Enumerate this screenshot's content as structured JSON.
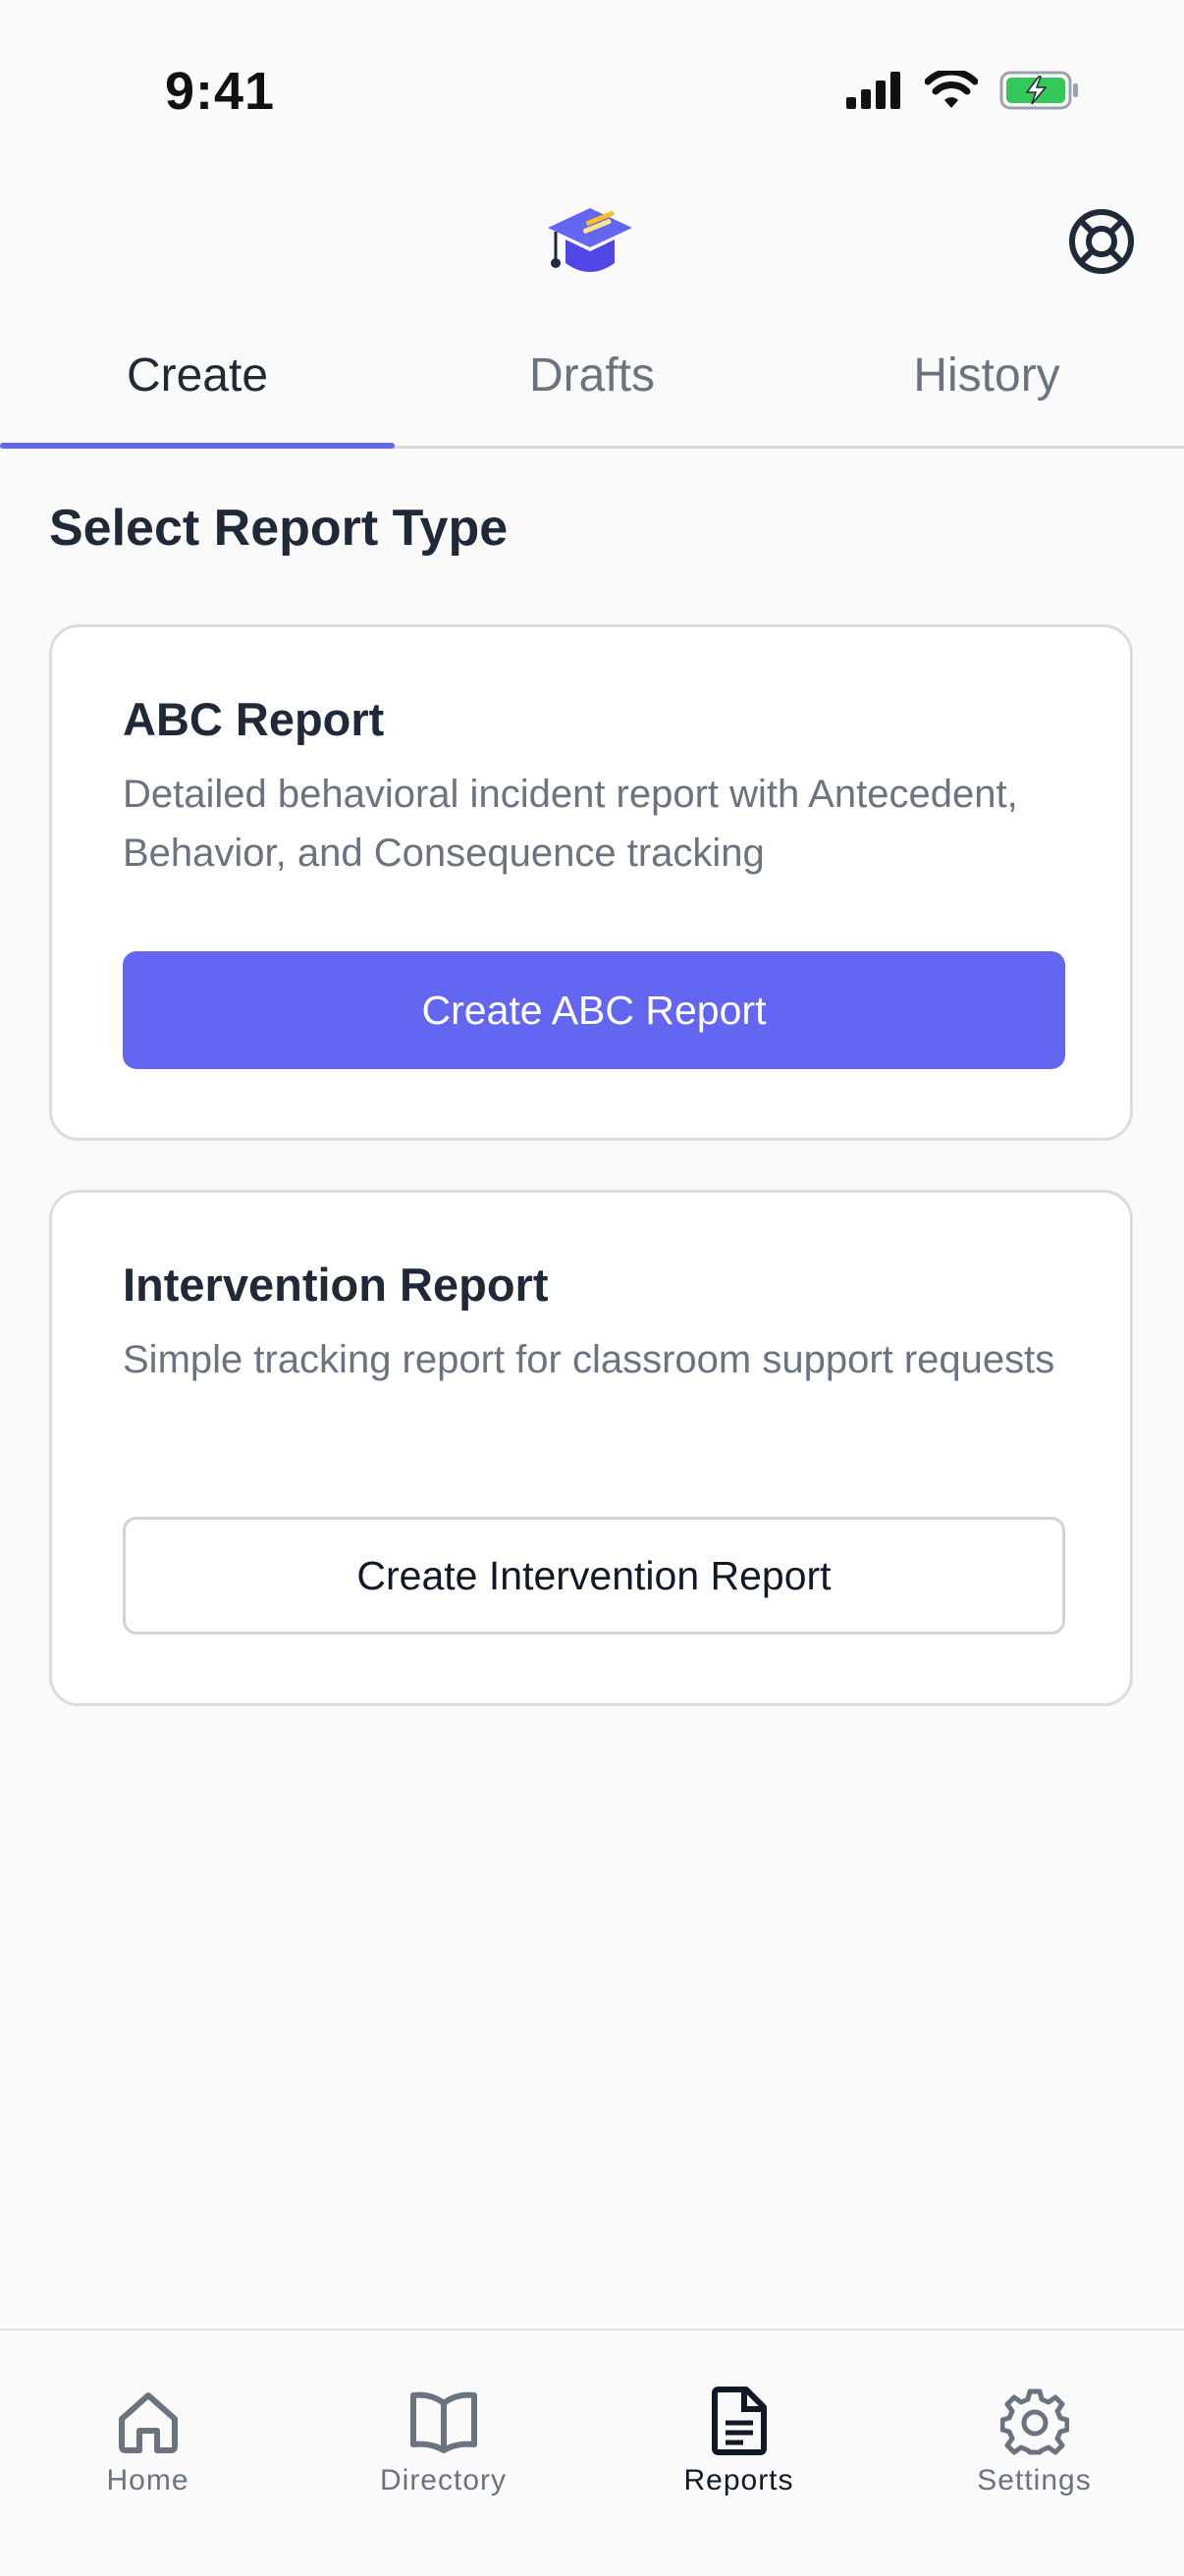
{
  "status_bar": {
    "time": "9:41"
  },
  "tabs": [
    {
      "label": "Create",
      "active": true
    },
    {
      "label": "Drafts",
      "active": false
    },
    {
      "label": "History",
      "active": false
    }
  ],
  "section_title": "Select Report Type",
  "cards": [
    {
      "title": "ABC Report",
      "description": "Detailed behavioral incident report with Antecedent, Behavior, and Consequence tracking",
      "button_label": "Create ABC Report"
    },
    {
      "title": "Intervention Report",
      "description": "Simple tracking report for classroom support requests",
      "button_label": "Create Intervention Report"
    }
  ],
  "bottom_nav": [
    {
      "label": "Home",
      "icon": "home-icon",
      "active": false
    },
    {
      "label": "Directory",
      "icon": "book-icon",
      "active": false
    },
    {
      "label": "Reports",
      "icon": "document-icon",
      "active": true
    },
    {
      "label": "Settings",
      "icon": "gear-icon",
      "active": false
    }
  ],
  "colors": {
    "accent": "#6366f1",
    "text_primary": "#1f2937",
    "text_secondary": "#6b7280",
    "background": "#fafafa"
  }
}
